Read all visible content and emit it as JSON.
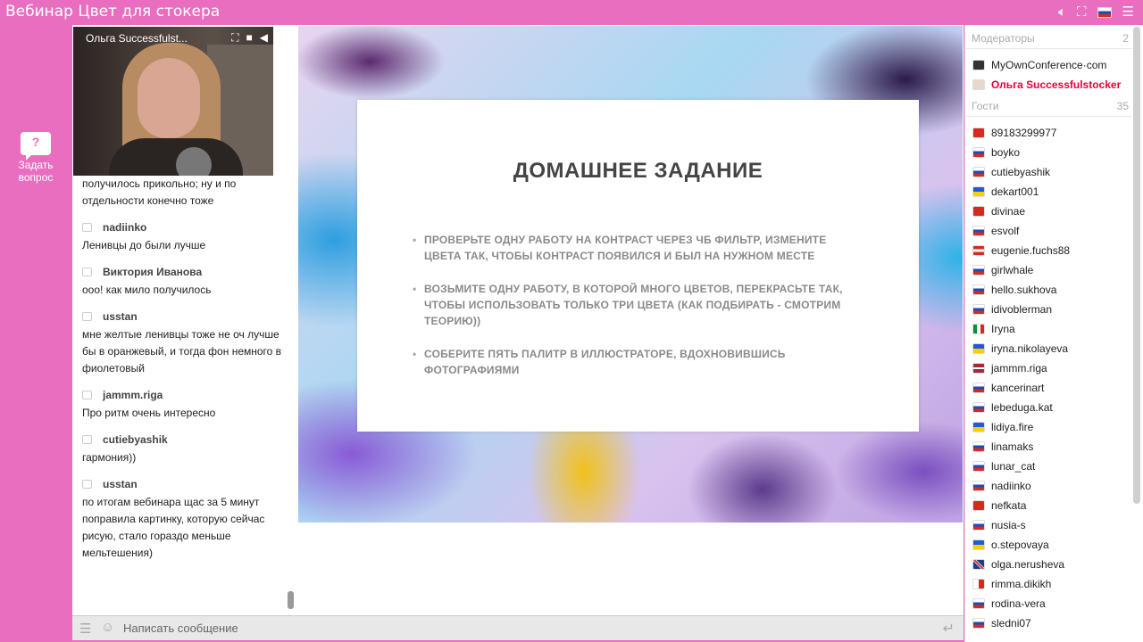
{
  "app": {
    "title": "Вебинар Цвет для стокера",
    "icons": [
      "volume-icon",
      "fullscreen-icon",
      "language-flag-ru-icon",
      "menu-icon"
    ]
  },
  "sidebar": {
    "ask_question_label": "Задать вопрос",
    "ask_question_line1": "Задать",
    "ask_question_line2": "вопрос"
  },
  "video": {
    "speaker_name": "Ольга Successfulst..."
  },
  "chat": {
    "partial_message": "получилось прикольно; ну и по отдельности конечно тоже",
    "messages": [
      {
        "author": "nadiinko",
        "text": "Ленивцы до были лучше"
      },
      {
        "author": "Виктория Иванова",
        "text": "ооо! как мило получилось"
      },
      {
        "author": "usstan",
        "text": "мне желтые ленивцы тоже не оч лучше бы в оранжевый, и тогда фон немного в фиолетовый"
      },
      {
        "author": "jammm.riga",
        "text": "Про ритм очень интересно"
      },
      {
        "author": "cutiebyashik",
        "text": "гармония))"
      },
      {
        "author": "usstan",
        "text": "по итогам вебинара щас за 5 минут поправила картинку, которую сейчас рисую, стало гораздо меньше мельтешения)"
      }
    ],
    "input_placeholder": "Написать сообщение"
  },
  "slide": {
    "title": "ДОМАШНЕЕ ЗАДАНИЕ",
    "bullets": [
      "ПРОВЕРЬТЕ ОДНУ РАБОТУ НА КОНТРАСТ ЧЕРЕЗ ЧБ ФИЛЬТР, ИЗМЕНИТЕ ЦВЕТА ТАК, ЧТОБЫ КОНТРАСТ ПОЯВИЛСЯ И БЫЛ НА НУЖНОМ МЕСТЕ",
      "ВОЗЬМИТЕ ОДНУ РАБОТУ, В КОТОРОЙ МНОГО ЦВЕТОВ, ПЕРЕКРАСЬТЕ ТАК, ЧТОБЫ ИСПОЛЬЗОВАТЬ ТОЛЬКО ТРИ ЦВЕТА (КАК ПОДБИРАТЬ - СМОТРИМ ТЕОРИЮ))",
      "СОБЕРИТЕ ПЯТЬ ПАЛИТР В ИЛЛЮСТРАТОРЕ, ВДОХНОВИВШИСЬ ФОТОГРАФИЯМИ"
    ]
  },
  "participants": {
    "moderators_label": "Модераторы",
    "moderators_count": "2",
    "moderators": [
      {
        "name": "MyOwnConference·com",
        "flag": "moc"
      },
      {
        "name": "Ольга Successfulstocker",
        "flag": "avatar"
      }
    ],
    "guests_label": "Гости",
    "guests_count": "35",
    "guests": [
      {
        "name": "89183299977",
        "flag": "hk"
      },
      {
        "name": "boyko",
        "flag": "ru"
      },
      {
        "name": "cutiebyashik",
        "flag": "ru"
      },
      {
        "name": "dekart001",
        "flag": "ua"
      },
      {
        "name": "divinae",
        "flag": "cn"
      },
      {
        "name": "esvolf",
        "flag": "ru"
      },
      {
        "name": "eugenie.fuchs88",
        "flag": "at"
      },
      {
        "name": "girlwhale",
        "flag": "ru"
      },
      {
        "name": "hello.sukhova",
        "flag": "ru"
      },
      {
        "name": "idivoblerman",
        "flag": "ru"
      },
      {
        "name": "Iryna",
        "flag": "it"
      },
      {
        "name": "iryna.nikolayeva",
        "flag": "ua"
      },
      {
        "name": "jammm.riga",
        "flag": "lv"
      },
      {
        "name": "kancerinart",
        "flag": "ru"
      },
      {
        "name": "lebeduga.kat",
        "flag": "ru"
      },
      {
        "name": "lidiya.fire",
        "flag": "ua"
      },
      {
        "name": "linamaks",
        "flag": "ru"
      },
      {
        "name": "lunar_cat",
        "flag": "ru"
      },
      {
        "name": "nadiinko",
        "flag": "ru"
      },
      {
        "name": "nefkata",
        "flag": "tr"
      },
      {
        "name": "nusia-s",
        "flag": "ru"
      },
      {
        "name": "o.stepovaya",
        "flag": "ua"
      },
      {
        "name": "olga.nerusheva",
        "flag": "gb"
      },
      {
        "name": "rimma.dikikh",
        "flag": "mt"
      },
      {
        "name": "rodina-vera",
        "flag": "ru"
      },
      {
        "name": "sledni07",
        "flag": "ru"
      }
    ]
  },
  "colors": {
    "accent": "#e96ec0",
    "moderator_name": "#e8003a"
  }
}
